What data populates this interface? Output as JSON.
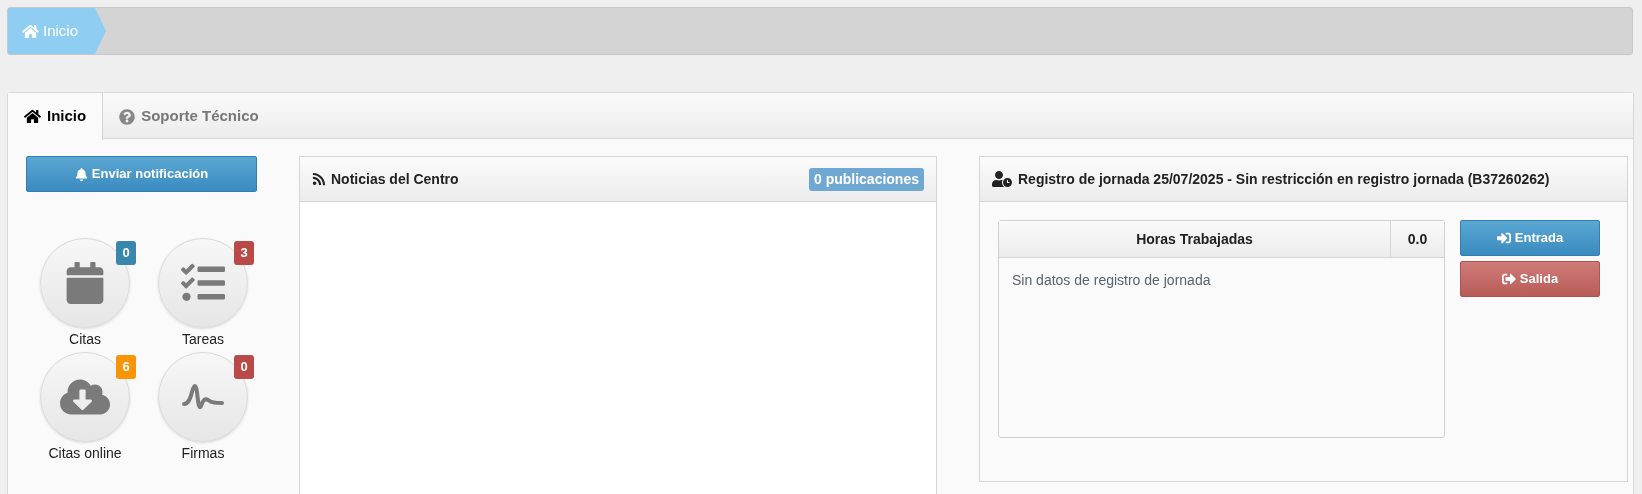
{
  "breadcrumb": [
    {
      "kind": "home",
      "label": "Inicio"
    }
  ],
  "tabs": [
    {
      "kind": "home",
      "label": "Inicio",
      "selected": true
    },
    {
      "kind": "help",
      "label": "Soporte Técnico",
      "selected": false
    }
  ],
  "notify_button": "Enviar notificación",
  "shortcuts": [
    {
      "kind": "calendar",
      "label": "Citas",
      "badge": "0",
      "color": "#3a87ad"
    },
    {
      "kind": "tasks",
      "label": "Tareas",
      "badge": "3",
      "color": "#b94a48"
    },
    {
      "kind": "cloud",
      "label": "Citas online",
      "badge": "6",
      "color": "#f89406"
    },
    {
      "kind": "signature",
      "label": "Firmas",
      "badge": "0",
      "color": "#b94a48"
    }
  ],
  "news": {
    "title": "Noticias del Centro",
    "badge": "0 publicaciones"
  },
  "attendance": {
    "title": "Registro de jornada 25/07/2025 - Sin restricción en registro jornada (B37260262)",
    "table_header": "Horas Trabajadas",
    "total": "0.0",
    "empty": "Sin datos de registro de jornada",
    "buttons": [
      {
        "kind": "in",
        "label": "Entrada"
      },
      {
        "kind": "out",
        "label": "Salida"
      }
    ]
  }
}
